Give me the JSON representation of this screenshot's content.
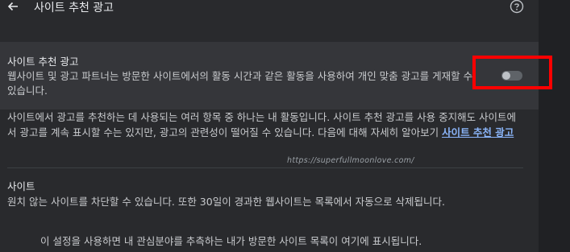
{
  "header": {
    "back_icon": "arrow-left-icon",
    "title": "사이트 추천 광고",
    "help_icon": "question-circle-icon"
  },
  "setting_row": {
    "title": "사이트 추천 광고",
    "description": "웹사이트 및 광고 파트너는 방문한 사이트에서의 활동 시간과 같은 활동을 사용하여 개인 맞춤 광고를 게재할 수 있습니다.",
    "toggle_state": "off"
  },
  "info": {
    "text": "사이트에서 광고를 추천하는 데 사용되는 여러 항목 중 하나는 내 활동입니다. 사이트 추천 광고를 사용 중지해도 사이트에서 광고를 계속 표시할 수는 있지만, 광고의 관련성이 떨어질 수 있습니다. 다음에 대해 자세히 알아보기 ",
    "link_label": "사이트 추천 광고"
  },
  "watermark": "https://superfullmoonlove.com/",
  "sites_section": {
    "title": "사이트",
    "description": "원치 않는 사이트를 차단할 수 있습니다. 또한 30일이 경과한 웹사이트는 목록에서 자동으로 삭제됩니다.",
    "empty_message": "이 설정을 사용하면 내 관심분야를 추측하는 내가 방문한 사이트 목록이 여기에 표시됩니다."
  },
  "colors": {
    "background": "#292a2d",
    "highlight": "#35363a",
    "link": "#8ab4f8",
    "annotation": "#ff0000"
  }
}
